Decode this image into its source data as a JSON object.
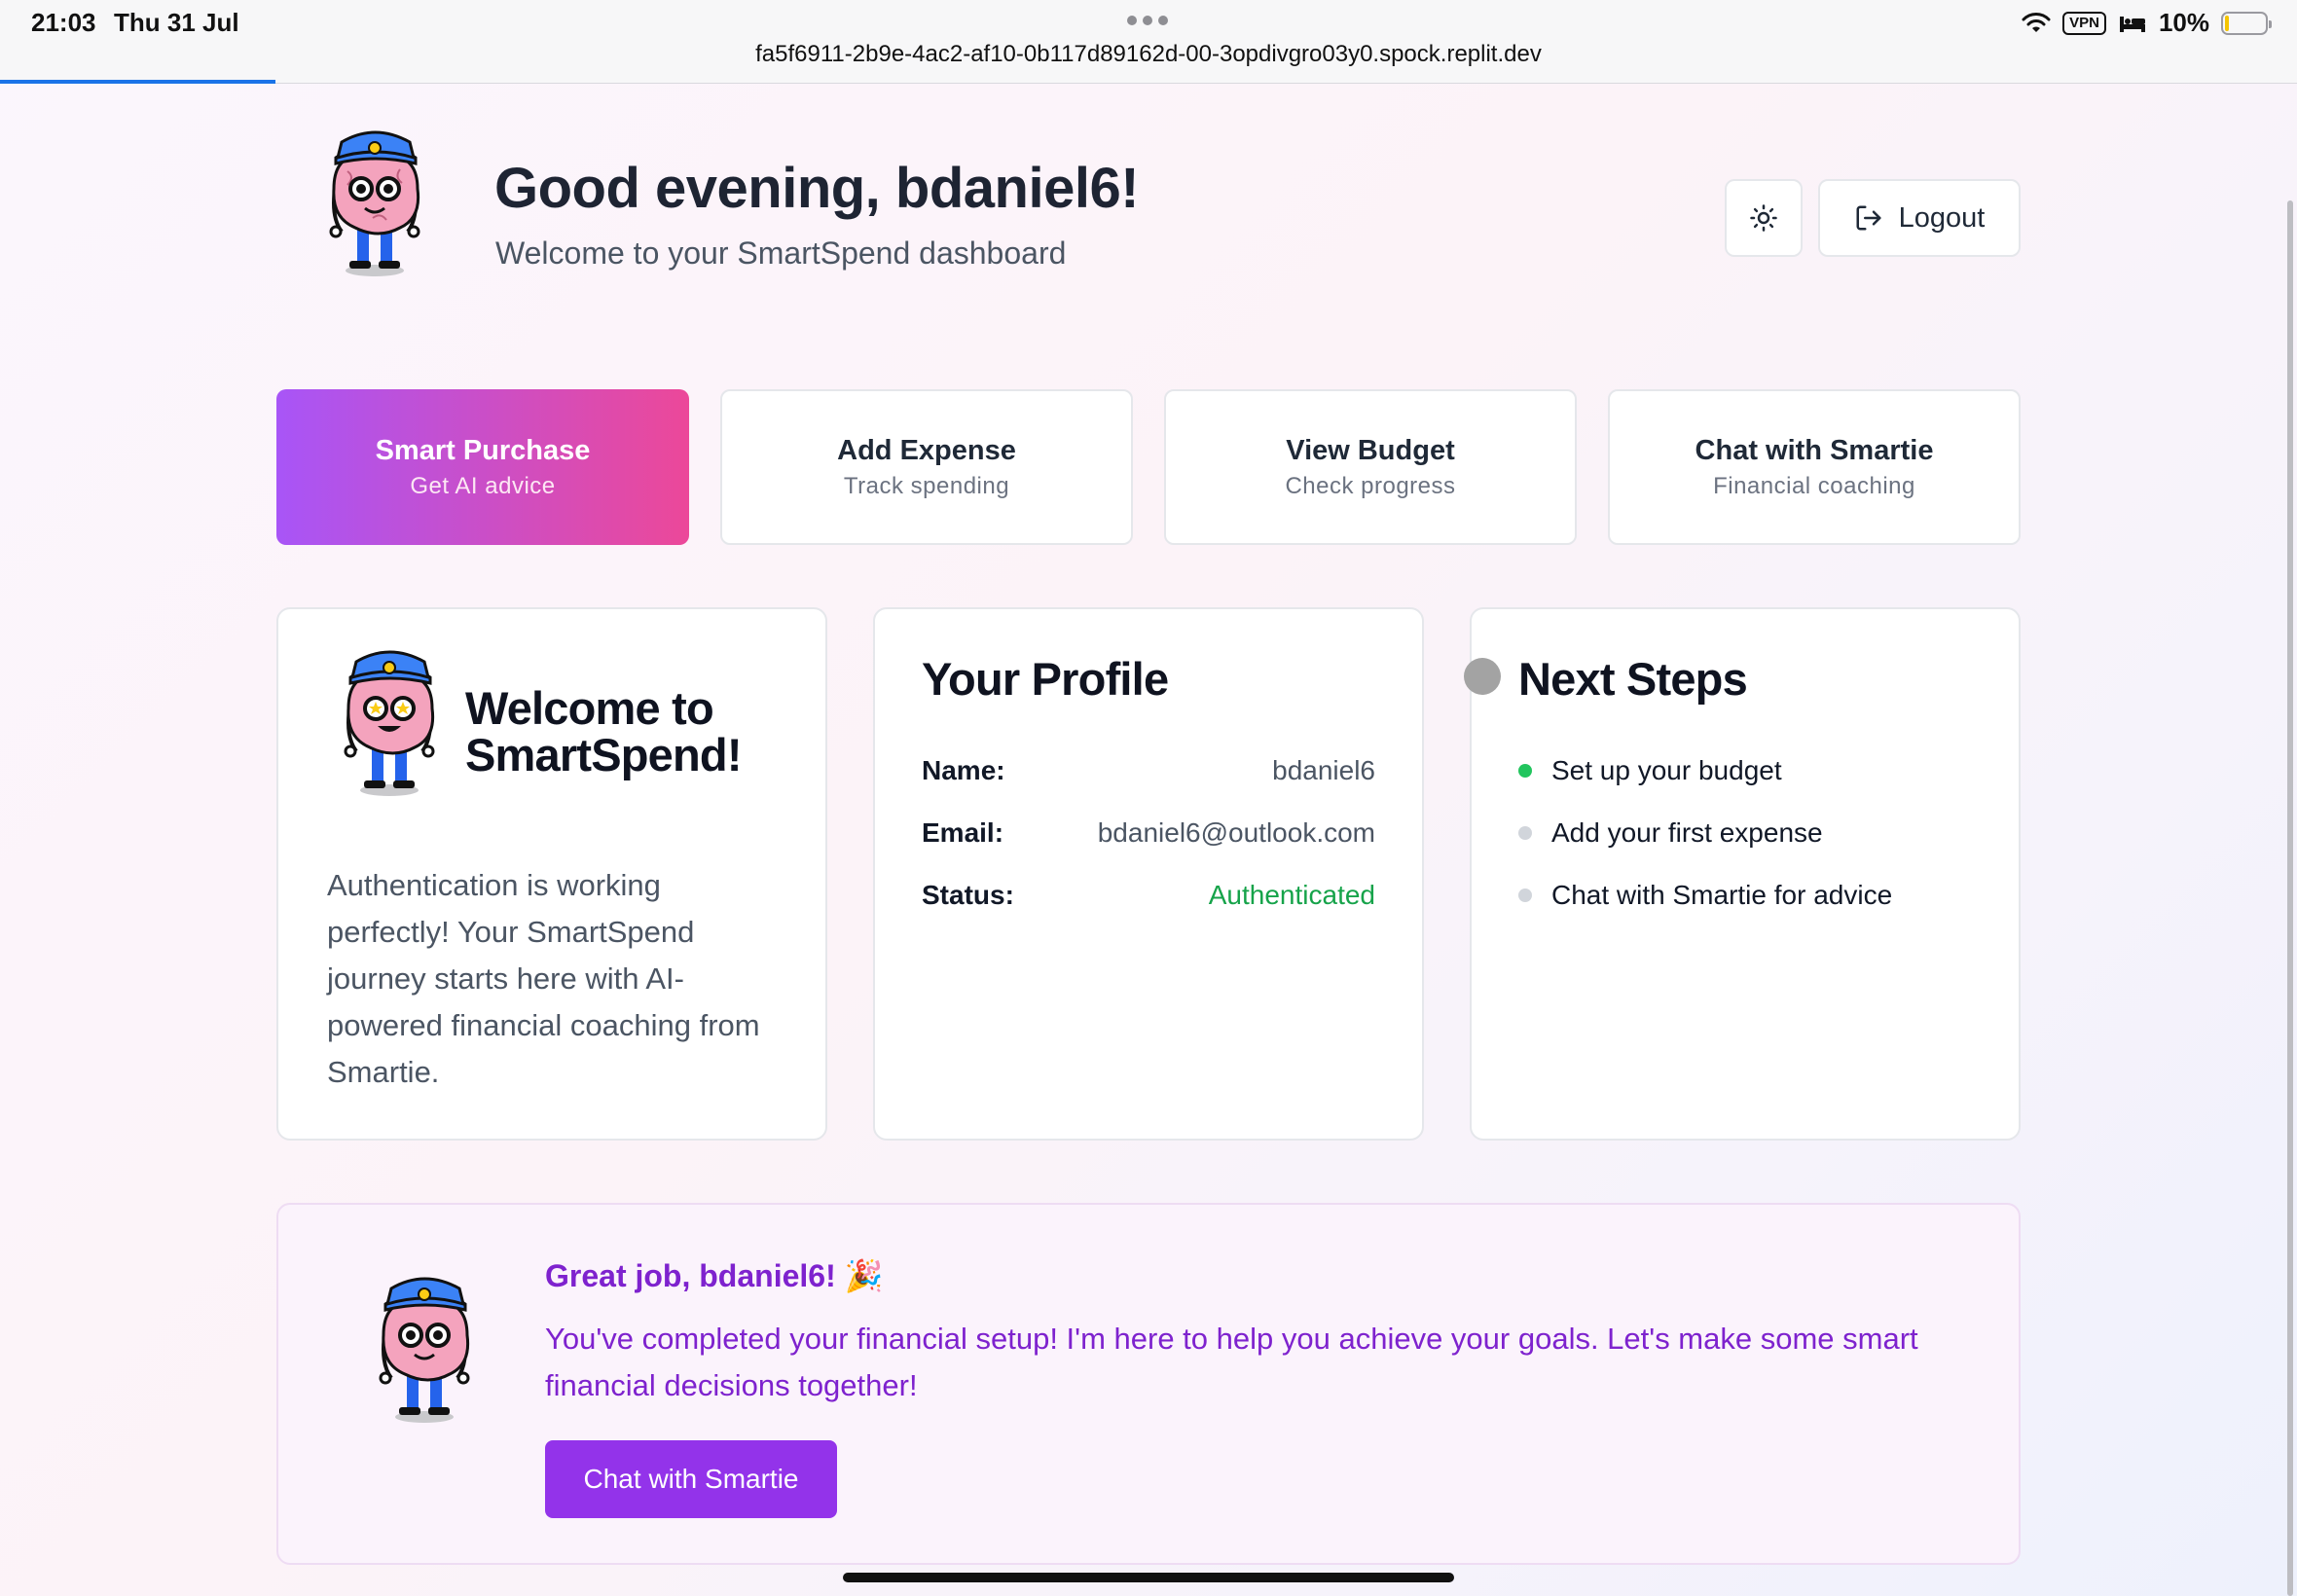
{
  "status_bar": {
    "time": "21:03",
    "date": "Thu 31 Jul",
    "url": "fa5f6911-2b9e-4ac2-af10-0b117d89162d-00-3opdivgro03y0.spock.replit.dev",
    "vpn_label": "VPN",
    "battery": "10%",
    "battery_level": 0.1,
    "page_load_progress": 0.12
  },
  "header": {
    "greeting": "Good evening, bdaniel6!",
    "subtitle": "Welcome to your SmartSpend dashboard",
    "logout_label": "Logout",
    "theme_toggle_icon": "sun-icon"
  },
  "actions": [
    {
      "title": "Smart Purchase",
      "subtitle": "Get AI advice"
    },
    {
      "title": "Add Expense",
      "subtitle": "Track spending"
    },
    {
      "title": "View Budget",
      "subtitle": "Check progress"
    },
    {
      "title": "Chat with Smartie",
      "subtitle": "Financial coaching"
    }
  ],
  "welcome_card": {
    "title": "Welcome to SmartSpend!",
    "body": "Authentication is working perfectly! Your SmartSpend journey starts here with AI-powered financial coaching from Smartie."
  },
  "profile_card": {
    "title": "Your Profile",
    "rows": [
      {
        "label": "Name:",
        "value": "bdaniel6"
      },
      {
        "label": "Email:",
        "value": "bdaniel6@outlook.com"
      },
      {
        "label": "Status:",
        "value": "Authenticated"
      }
    ]
  },
  "next_steps": {
    "title": "Next Steps",
    "items": [
      {
        "label": "Set up your budget",
        "done": true
      },
      {
        "label": "Add your first expense",
        "done": false
      },
      {
        "label": "Chat with Smartie for advice",
        "done": false
      }
    ]
  },
  "banner": {
    "title": "Great job, bdaniel6! 🎉",
    "text": "You've completed your financial setup! I'm here to help you achieve your goals. Let's make some smart financial decisions together!",
    "button_label": "Chat with Smartie"
  },
  "colors": {
    "primary_purple": "#9333ea",
    "primary_gradient_start": "#a855f7",
    "primary_gradient_end": "#ec4899",
    "success_green": "#16a34a"
  }
}
